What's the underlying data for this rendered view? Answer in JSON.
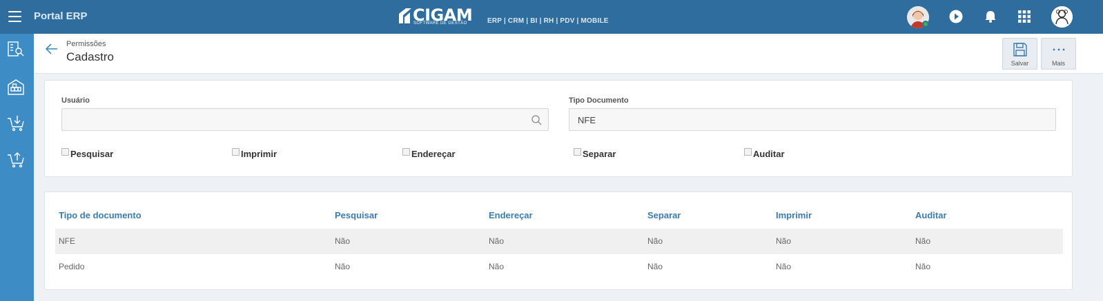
{
  "topbar": {
    "menu_icon": "hamburger-icon",
    "title": "Portal ERP",
    "logo_text": "CIGAM",
    "logo_subtext": "SOFTWARE DE GESTÃO",
    "modules": "ERP | CRM | BI | RH | PDV | MOBILE",
    "icons": [
      "avatar-icon",
      "play-icon",
      "bell-icon",
      "apps-grid-icon",
      "user-avatar-icon"
    ],
    "status_color": "#3db34a"
  },
  "sidebar": {
    "icons": [
      "inventory-search-icon",
      "warehouse-icon",
      "cart-receive-icon",
      "cart-ship-icon"
    ]
  },
  "header": {
    "breadcrumb": "Permissões",
    "title": "Cadastro",
    "actions": [
      {
        "label": "Salvar",
        "icon": "save-icon"
      },
      {
        "label": "Mais",
        "icon": "more-icon"
      }
    ]
  },
  "form": {
    "usuario_label": "Usuário",
    "usuario_value": "",
    "tipo_documento_label": "Tipo Documento",
    "tipo_documento_value": "NFE",
    "checkboxes": [
      {
        "label": "Pesquisar",
        "checked": false
      },
      {
        "label": "Imprimir",
        "checked": false
      },
      {
        "label": "Endereçar",
        "checked": false
      },
      {
        "label": "Separar",
        "checked": false
      },
      {
        "label": "Auditar",
        "checked": false
      }
    ]
  },
  "table": {
    "columns": [
      "Tipo de documento",
      "Pesquisar",
      "Endereçar",
      "Separar",
      "Imprimir",
      "Auditar"
    ],
    "rows": [
      [
        "NFE",
        "Não",
        "Não",
        "Não",
        "Não",
        "Não"
      ],
      [
        "Pedido",
        "Não",
        "Não",
        "Não",
        "Não",
        "Não"
      ]
    ]
  },
  "colors": {
    "topbar": "#2e6d9e",
    "sidebar": "#3d8cc5",
    "table_header_text": "#3a7bb0",
    "row_stripe": "#f0f0f0"
  }
}
